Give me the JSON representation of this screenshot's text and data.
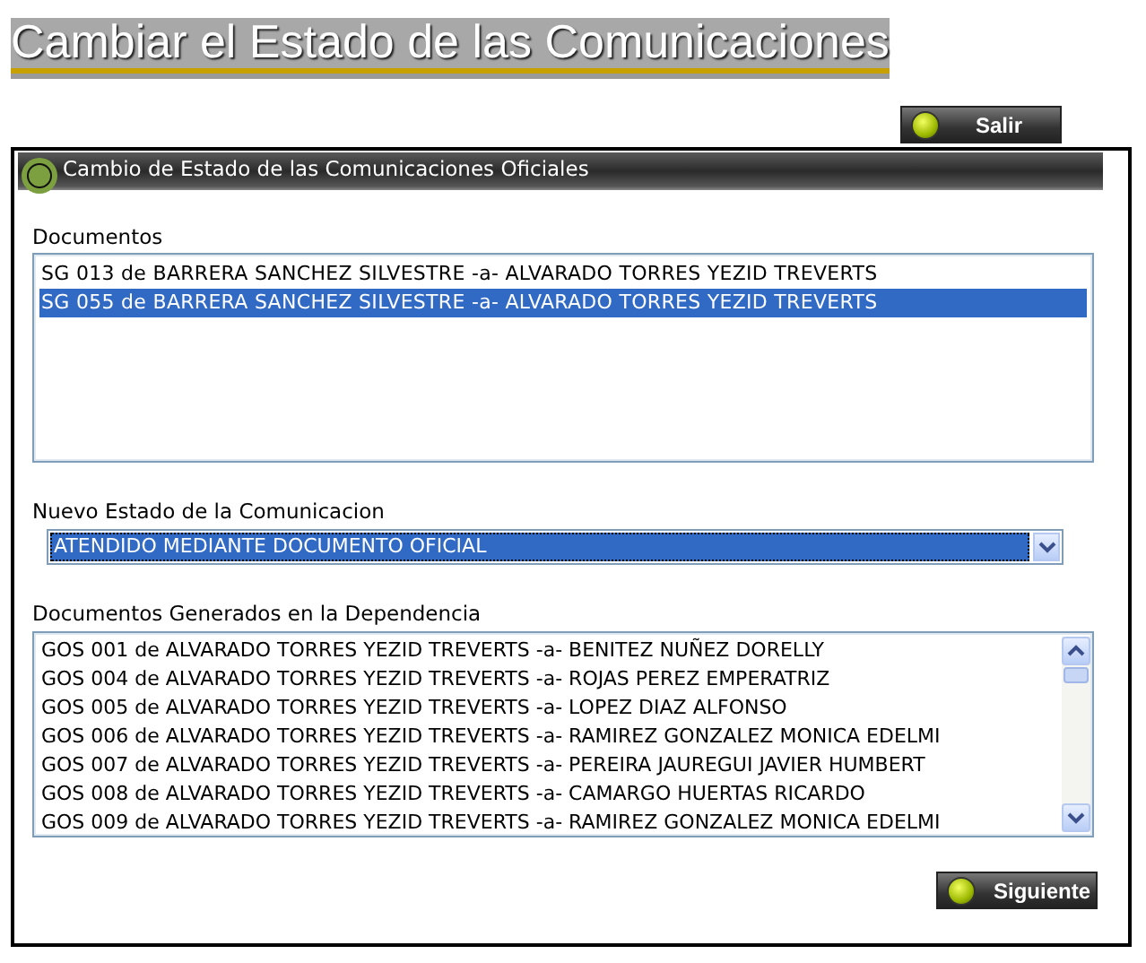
{
  "page_title": "Cambiar el Estado de las Comunicaciones",
  "exit_button": {
    "label": "Salir"
  },
  "panel": {
    "title": "Cambio de Estado de las Comunicaciones Oficiales",
    "documents": {
      "label": "Documentos",
      "items": [
        {
          "text": "SG 013 de BARRERA SANCHEZ SILVESTRE -a- ALVARADO TORRES YEZID TREVERTS",
          "selected": false
        },
        {
          "text": "SG 055 de BARRERA SANCHEZ SILVESTRE -a- ALVARADO TORRES YEZID TREVERTS",
          "selected": true
        }
      ]
    },
    "new_state": {
      "label": "Nuevo Estado de la Comunicacion",
      "value": "ATENDIDO MEDIANTE DOCUMENTO OFICIAL",
      "highlighted": true
    },
    "generated": {
      "label": "Documentos Generados en la Dependencia",
      "items": [
        {
          "text": "GOS 001 de ALVARADO TORRES YEZID TREVERTS -a- BENITEZ NUÑEZ DORELLY",
          "selected": false
        },
        {
          "text": "GOS 004 de ALVARADO TORRES YEZID TREVERTS -a- ROJAS PEREZ EMPERATRIZ",
          "selected": false
        },
        {
          "text": "GOS 005 de ALVARADO TORRES YEZID TREVERTS -a- LOPEZ DIAZ ALFONSO",
          "selected": false
        },
        {
          "text": "GOS 006 de ALVARADO TORRES YEZID TREVERTS -a- RAMIREZ GONZALEZ MONICA EDELMI",
          "selected": false
        },
        {
          "text": "GOS 007 de ALVARADO TORRES YEZID TREVERTS -a- PEREIRA JAUREGUI JAVIER HUMBERT",
          "selected": false
        },
        {
          "text": "GOS 008 de ALVARADO TORRES YEZID TREVERTS -a- CAMARGO HUERTAS RICARDO",
          "selected": false
        },
        {
          "text": "GOS 009 de ALVARADO TORRES YEZID TREVERTS -a- RAMIREZ GONZALEZ MONICA EDELMI",
          "selected": false
        }
      ]
    },
    "next_button": {
      "label": "Siguiente"
    }
  }
}
